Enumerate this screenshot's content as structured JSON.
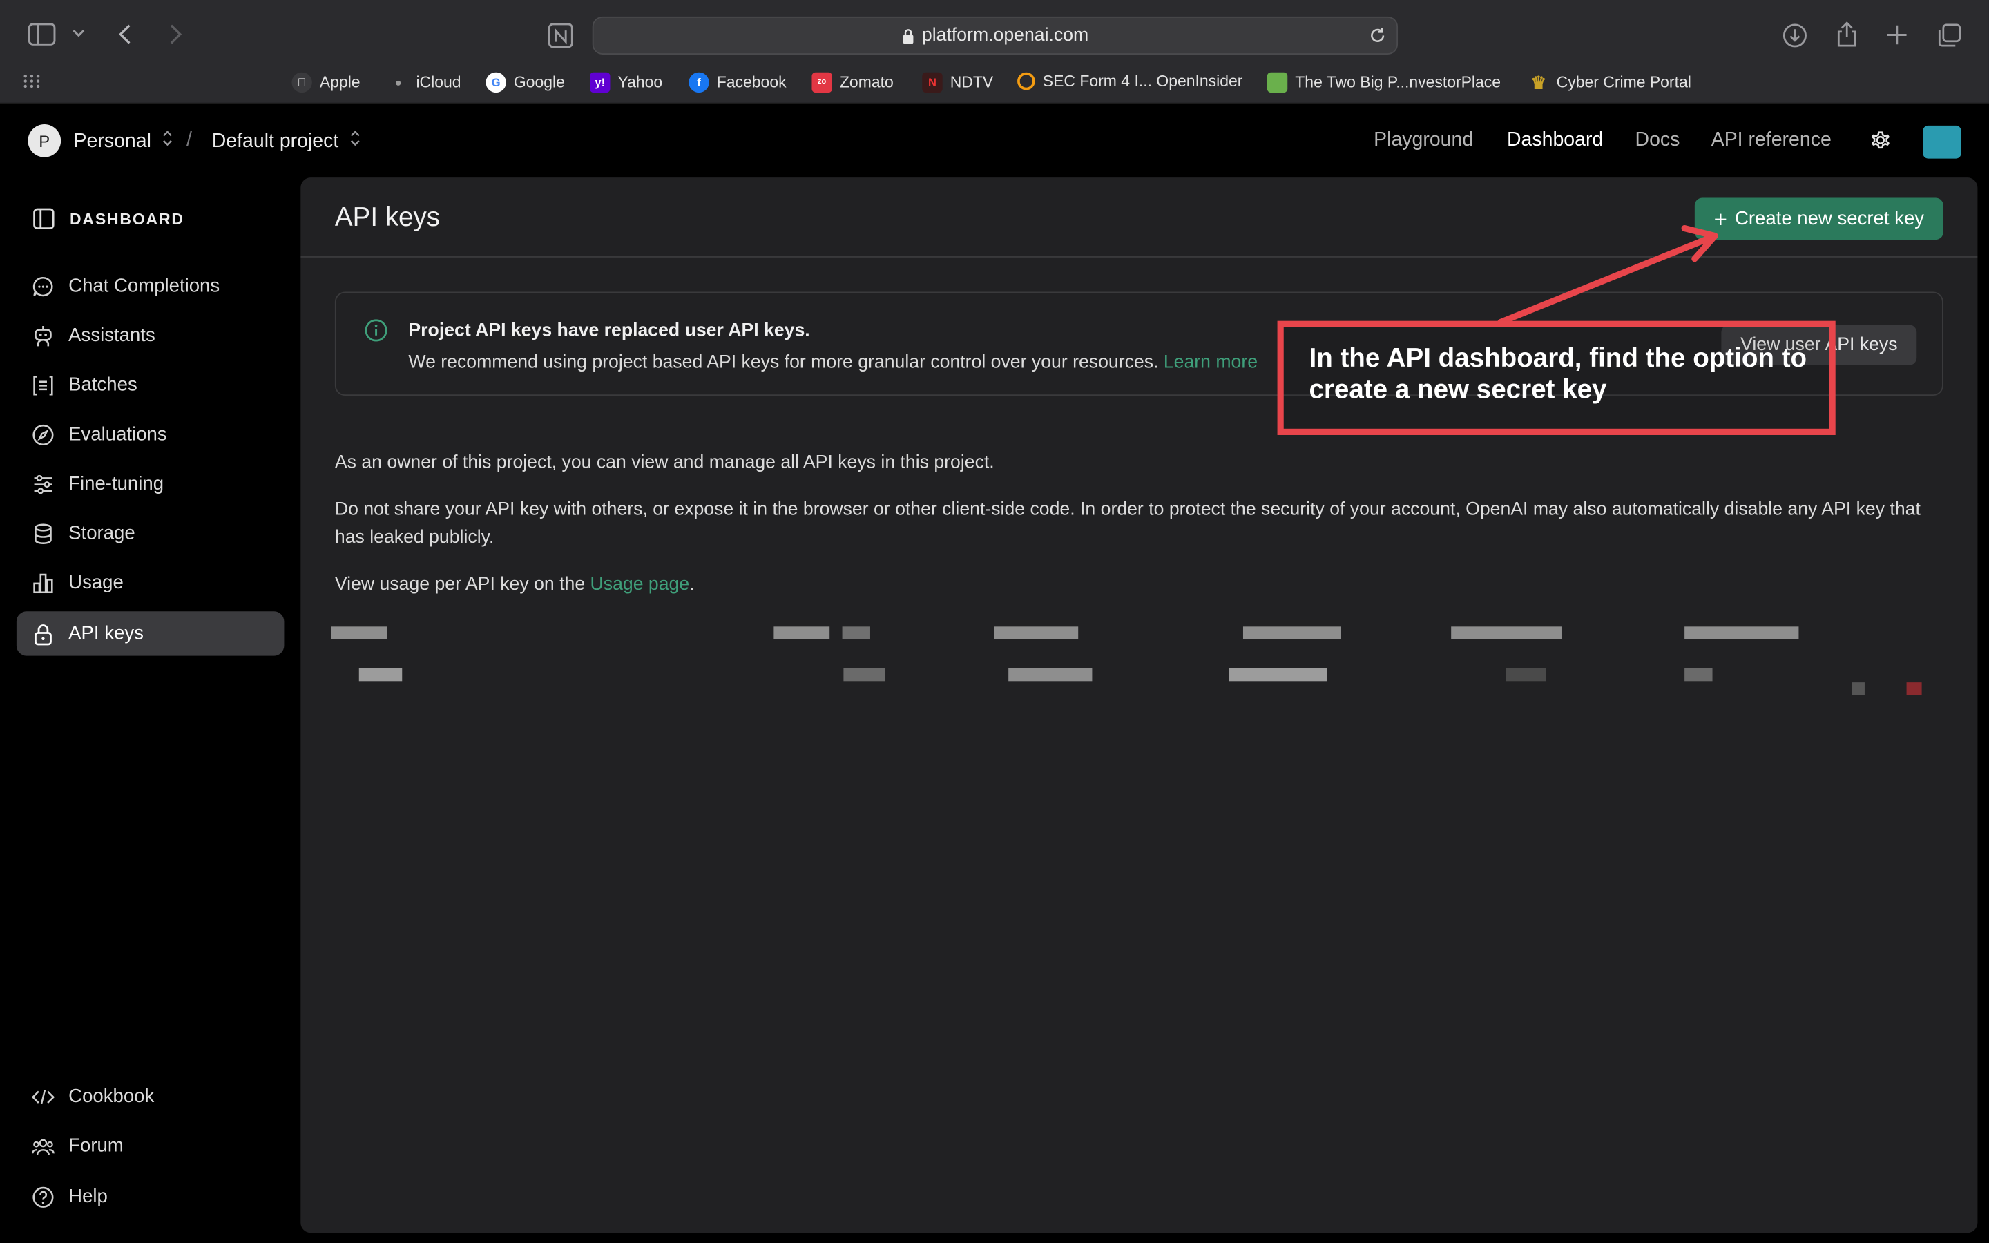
{
  "browser": {
    "url": "platform.openai.com",
    "bookmarks": [
      {
        "label": "Apple",
        "color": "#ffffff"
      },
      {
        "label": "iCloud",
        "color": "#9a9a9a"
      },
      {
        "label": "Google",
        "color": "#4285f4"
      },
      {
        "label": "Yahoo",
        "color": "#6001d2"
      },
      {
        "label": "Facebook",
        "color": "#1877f2"
      },
      {
        "label": "Zomato",
        "color": "#e23744"
      },
      {
        "label": "NDTV",
        "color": "#c4161c"
      },
      {
        "label": "SEC Form 4 I... OpenInsider",
        "color": "#f39c12"
      },
      {
        "label": "The Two Big P...nvestorPlace",
        "color": "#6ab04c"
      },
      {
        "label": "Cyber Crime Portal",
        "color": "#c9a227"
      }
    ]
  },
  "header": {
    "avatar_initial": "P",
    "org": "Personal",
    "separator": "/",
    "project": "Default project",
    "nav": [
      "Playground",
      "Dashboard",
      "Docs",
      "API reference"
    ],
    "active_nav": "Dashboard"
  },
  "sidebar": {
    "title": "DASHBOARD",
    "items": [
      {
        "label": "Chat Completions",
        "icon": "chat-bubble-icon"
      },
      {
        "label": "Assistants",
        "icon": "robot-icon"
      },
      {
        "label": "Batches",
        "icon": "batches-icon"
      },
      {
        "label": "Evaluations",
        "icon": "compass-icon"
      },
      {
        "label": "Fine-tuning",
        "icon": "sliders-icon"
      },
      {
        "label": "Storage",
        "icon": "database-icon"
      },
      {
        "label": "Usage",
        "icon": "bar-chart-icon"
      },
      {
        "label": "API keys",
        "icon": "lock-icon",
        "active": true
      }
    ],
    "footer": [
      {
        "label": "Cookbook",
        "icon": "code-icon"
      },
      {
        "label": "Forum",
        "icon": "users-icon"
      },
      {
        "label": "Help",
        "icon": "help-icon"
      }
    ]
  },
  "main": {
    "title": "API keys",
    "create_button": "Create new secret key",
    "notice": {
      "title": "Project API keys have replaced user API keys.",
      "body": "We recommend using project based API keys for more granular control over your resources.",
      "link": "Learn more",
      "button": "View user API keys"
    },
    "p1": "As an owner of this project, you can view and manage all API keys in this project.",
    "p2": "Do not share your API key with others, or expose it in the browser or other client-side code. In order to protect the security of your account, OpenAI may also automatically disable any API key that has leaked publicly.",
    "p3_prefix": "View usage per API key on the",
    "p3_link": "Usage page",
    "p3_suffix": "."
  },
  "annotation": {
    "text": "In the API dashboard, find the option to create a new secret key",
    "color": "#e8454b"
  }
}
